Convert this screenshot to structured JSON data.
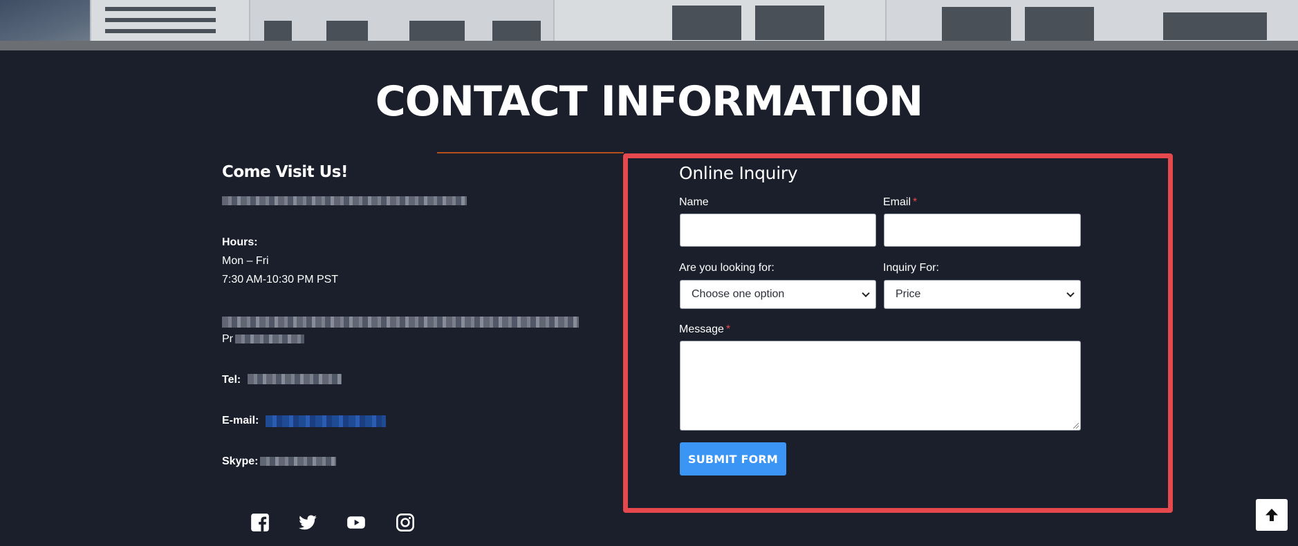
{
  "page": {
    "title": "CONTACT INFORMATION"
  },
  "visit": {
    "heading": "Come Visit Us!",
    "hours_label": "Hours:",
    "hours_days": "Mon – Fri",
    "hours_time": "7:30 AM-10:30 PM PST",
    "address_line2_visible": "Pr",
    "tel_label": "Tel:",
    "email_label": "E-mail:",
    "skype_label": "Skype:"
  },
  "social": {
    "icons": [
      "facebook-icon",
      "twitter-icon",
      "youtube-icon",
      "instagram-icon"
    ]
  },
  "form": {
    "title": "Online Inquiry",
    "name_label": "Name",
    "email_label": "Email",
    "required_mark": "*",
    "looking_for_label": "Are you looking for:",
    "looking_for_value": "Choose one option",
    "inquiry_for_label": "Inquiry For:",
    "inquiry_for_value": "Price",
    "message_label": "Message",
    "submit_label": "SUBMIT FORM"
  },
  "colors": {
    "background": "#1b1f2c",
    "highlight_border": "#e5484d",
    "submit_button": "#3b95f5",
    "accent_rule": "#b4501e"
  },
  "back_to_top": {
    "icon": "arrow-up-icon"
  }
}
